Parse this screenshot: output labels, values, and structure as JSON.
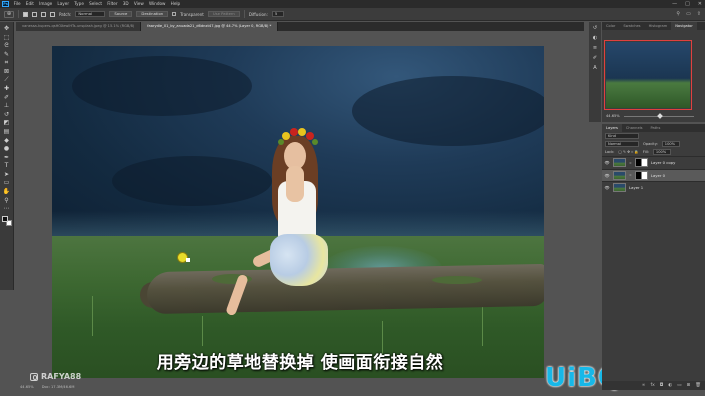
{
  "menubar": {
    "logo": "Ps",
    "items": [
      "File",
      "Edit",
      "Image",
      "Layer",
      "Type",
      "Select",
      "Filter",
      "3D",
      "View",
      "Window",
      "Help"
    ],
    "window_controls": [
      "—",
      "□",
      "✕"
    ]
  },
  "options": {
    "patch_label": "Patch:",
    "patch_mode": "Normal",
    "source_label": "Source",
    "destination_label": "Destination",
    "transparent_label": "Transparent",
    "use_pattern_label": "Use Pattern",
    "diffusion_label": "Diffusion:",
    "diffusion_value": "5"
  },
  "tabs": [
    {
      "label": "vanessa-kupers-qsHOXewlHTs-unsplash.jpeg @ 15.1% (RGB/8)",
      "active": false
    },
    {
      "label": "faarydie_01_by_anuada21_d6dnxt47.jpg @ 44.7% (Layer 0, RGB/8) *",
      "active": true
    }
  ],
  "toolbar": {
    "tools": [
      {
        "name": "move-tool-icon",
        "glyph": "✥"
      },
      {
        "name": "marquee-tool-icon",
        "glyph": "⬚"
      },
      {
        "name": "lasso-tool-icon",
        "glyph": "ᘓ"
      },
      {
        "name": "quick-select-tool-icon",
        "glyph": "✎"
      },
      {
        "name": "crop-tool-icon",
        "glyph": "⌗"
      },
      {
        "name": "frame-tool-icon",
        "glyph": "⊠"
      },
      {
        "name": "eyedropper-tool-icon",
        "glyph": "⟋"
      },
      {
        "name": "healing-brush-tool-icon",
        "glyph": "✚"
      },
      {
        "name": "brush-tool-icon",
        "glyph": "✐"
      },
      {
        "name": "clone-stamp-tool-icon",
        "glyph": "⊥"
      },
      {
        "name": "history-brush-tool-icon",
        "glyph": "↺"
      },
      {
        "name": "eraser-tool-icon",
        "glyph": "◩"
      },
      {
        "name": "gradient-tool-icon",
        "glyph": "▤"
      },
      {
        "name": "blur-tool-icon",
        "glyph": "◆"
      },
      {
        "name": "dodge-tool-icon",
        "glyph": "●"
      },
      {
        "name": "pen-tool-icon",
        "glyph": "✒"
      },
      {
        "name": "type-tool-icon",
        "glyph": "T"
      },
      {
        "name": "path-select-tool-icon",
        "glyph": "➤"
      },
      {
        "name": "shape-tool-icon",
        "glyph": "▭"
      },
      {
        "name": "hand-tool-icon",
        "glyph": "✋"
      },
      {
        "name": "zoom-tool-icon",
        "glyph": "⚲"
      },
      {
        "name": "more-tools-icon",
        "glyph": "⋯"
      }
    ]
  },
  "canvas": {
    "subtitle": "用旁边的草地替换掉 使画面衔接自然"
  },
  "statusbar": {
    "zoom": "44.65%",
    "doc_info": "Doc: 17.3M/46.6M"
  },
  "watermark": {
    "handle": "RAFYA88",
    "brand": "UiBQ.CoM"
  },
  "navigator": {
    "tabs": [
      {
        "label": "Color",
        "active": false
      },
      {
        "label": "Swatches",
        "active": false
      },
      {
        "label": "Histogram",
        "active": false
      },
      {
        "label": "Navigator",
        "active": true
      }
    ],
    "zoom": "44.65%"
  },
  "layers": {
    "tabs": [
      {
        "label": "Layers",
        "active": true
      },
      {
        "label": "Channels",
        "active": false
      },
      {
        "label": "Paths",
        "active": false
      }
    ],
    "filter_label": "Kind",
    "blend_mode": "Normal",
    "opacity_label": "Opacity:",
    "opacity_value": "100%",
    "lock_label": "Lock:",
    "fill_label": "Fill:",
    "fill_value": "100%",
    "items": [
      {
        "name": "Layer 0 copy",
        "selected": false,
        "has_mask": true
      },
      {
        "name": "Layer 0",
        "selected": true,
        "has_mask": true
      },
      {
        "name": "Layer 1",
        "selected": false,
        "has_mask": false
      }
    ],
    "footer_icons": [
      "link-icon",
      "fx-icon",
      "mask-icon",
      "adjustment-icon",
      "group-icon",
      "new-layer-icon",
      "trash-icon"
    ]
  }
}
